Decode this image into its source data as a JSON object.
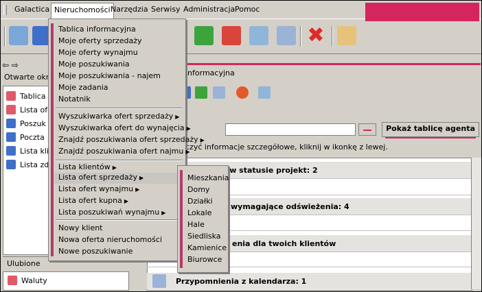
{
  "menubar": [
    "Galactica",
    "Nieruchomości",
    "Narzędzia",
    "Serwisy",
    "Administracja",
    "Pomoc"
  ],
  "nieruchomosci_menu": {
    "group1": [
      "Tablica informacyjna",
      "Moje oferty sprzedaży",
      "Moje oferty wynajmu",
      "Moje poszukiwania",
      "Moje poszukiwania - najem",
      "Moje zadania",
      "Notatnik"
    ],
    "group2": [
      "Wyszukiwarka ofert sprzedaży",
      "Wyszukiwarka ofert do wynajęcia",
      "Znajdź poszukiwania ofert sprzedaży",
      "Znajdź poszukiwania ofert najmu"
    ],
    "group3": [
      "Lista klientów",
      "Lista ofert sprzedaży",
      "Lista ofert wynajmu",
      "Lista ofert kupna",
      "Lista poszukiwań wynajmu"
    ],
    "group4": [
      "Nowy klient",
      "Nowa oferta nieruchomości",
      "Nowe poszukiwanie"
    ]
  },
  "submenu": [
    "Mieszkania",
    "Domy",
    "Działki",
    "Lokale",
    "Hale",
    "Siedliska",
    "Kamienice",
    "Biurowce"
  ],
  "left": {
    "header": "Otwarte okn",
    "items": [
      "Tablica",
      "Lista ofe",
      "Poszuk",
      "Poczta",
      "Lista kli",
      "Lista zd"
    ],
    "favorites": "Ulubione",
    "fav_item": "Waluty"
  },
  "right": {
    "title": "informacyjna",
    "button": "Pokaż tablicę agenta",
    "info": "czyć informacje szczegółowe, kliknij w ikonkę z lewej.",
    "sections": [
      "kończone, w statusie projekt: 2",
      "wymagające odświeżenia: 4",
      "enia dla twoich klientów",
      "Przypomnienia z kalendarza: 1"
    ]
  },
  "colors": {
    "accent": "#d5255f",
    "stripe": "#b53b6c"
  }
}
